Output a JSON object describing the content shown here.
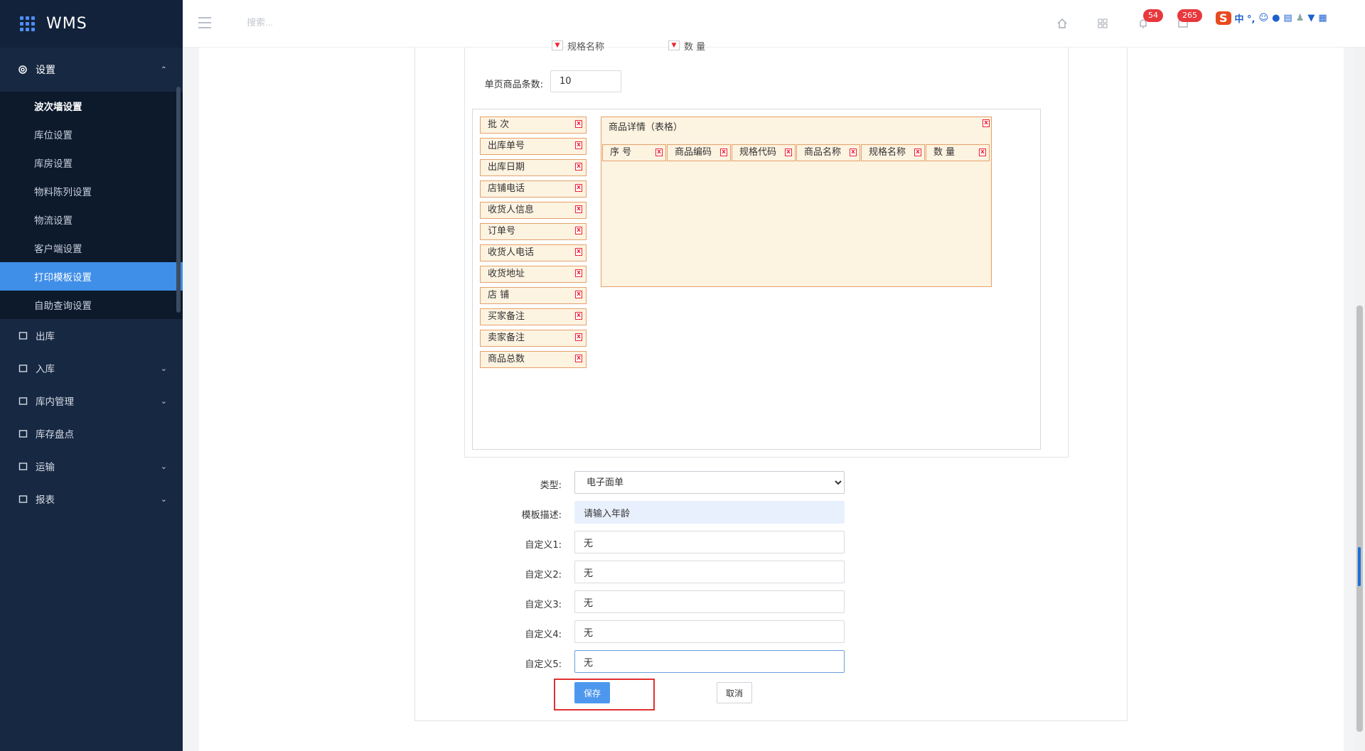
{
  "app": {
    "name": "WMS"
  },
  "header": {
    "search_placeholder": "搜索...",
    "notif_count": "54",
    "msg_count": "265",
    "ime_logo": "S",
    "ime_text": "中 °,"
  },
  "sidebar": {
    "settings_label": "设置",
    "settings_items": [
      "波次墙设置",
      "库位设置",
      "库房设置",
      "物料陈列设置",
      "物流设置",
      "客户端设置",
      "打印模板设置",
      "自助查询设置"
    ],
    "items": [
      {
        "label": "出库",
        "icon": "outbound-icon",
        "caret": false
      },
      {
        "label": "入库",
        "icon": "inbound-icon",
        "caret": true
      },
      {
        "label": "库内管理",
        "icon": "warehouse-icon",
        "caret": true
      },
      {
        "label": "库存盘点",
        "icon": "inventory-icon",
        "caret": false
      },
      {
        "label": "运输",
        "icon": "truck-icon",
        "caret": true
      },
      {
        "label": "报表",
        "icon": "report-icon",
        "caret": true
      }
    ]
  },
  "top": {
    "col_a": "规格名称",
    "col_b": "数 量",
    "page_items_label": "单页商品条数:",
    "page_items_value": "10"
  },
  "fields": [
    "批 次",
    "出库单号",
    "出库日期",
    "店铺电话",
    "收货人信息",
    "订单号",
    "收货人电话",
    "收货地址",
    "店 铺",
    "买家备注",
    "卖家备注",
    "商品总数"
  ],
  "table": {
    "title": "商品详情（表格）",
    "columns": [
      "序 号",
      "商品编码",
      "规格代码",
      "商品名称",
      "规格名称",
      "数 量"
    ]
  },
  "form": {
    "type_label": "类型:",
    "type_value": "电子面单",
    "desc_label": "模板描述:",
    "desc_value": "请输入年龄",
    "custom1_label": "自定义1:",
    "custom1_value": "无",
    "custom2_label": "自定义2:",
    "custom2_value": "无",
    "custom3_label": "自定义3:",
    "custom3_value": "无",
    "custom4_label": "自定义4:",
    "custom4_value": "无",
    "custom5_label": "自定义5:",
    "custom5_value": "无",
    "save_label": "保存",
    "cancel_label": "取消"
  }
}
